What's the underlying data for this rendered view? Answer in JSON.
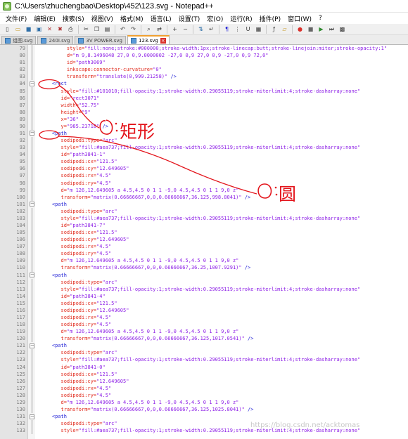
{
  "window": {
    "title": "C:\\Users\\zhuchengbao\\Desktop\\452\\123.svg - Notepad++"
  },
  "menu": [
    "文件(F)",
    "编辑(E)",
    "搜索(S)",
    "视图(V)",
    "格式(M)",
    "语言(L)",
    "设置(T)",
    "宏(O)",
    "运行(R)",
    "插件(P)",
    "窗口(W)",
    "?"
  ],
  "toolbar_icons": [
    "new-file-icon",
    "open-file-icon",
    "save-icon",
    "save-all-icon",
    "close-icon",
    "close-all-icon",
    "print-icon",
    "cut-icon",
    "copy-icon",
    "paste-icon",
    "undo-icon",
    "redo-icon",
    "find-icon",
    "replace-icon",
    "zoom-in-icon",
    "zoom-out-icon",
    "sync-scroll-icon",
    "word-wrap-icon",
    "show-all-chars-icon",
    "indent-guide-icon",
    "user-language-icon",
    "doc-map-icon",
    "function-list-icon",
    "folder-as-workspace-icon",
    "record-macro-icon",
    "stop-macro-icon",
    "play-macro-icon",
    "run-macro-icon",
    "save-macro-icon"
  ],
  "tabs": [
    {
      "label": "组图.svg",
      "active": false
    },
    {
      "label": "240I.svg",
      "active": false
    },
    {
      "label": "3V POWER.svg",
      "active": false
    },
    {
      "label": "123.svg",
      "active": true
    }
  ],
  "code_lines": [
    {
      "n": "79",
      "parts": [
        [
          "attr",
          "         style="
        ],
        [
          "val",
          "\"fill:none;stroke:#000000;stroke-width:1px;stroke-linecap:butt;stroke-linejoin:miter;stroke-opacity:1\""
        ]
      ]
    },
    {
      "n": "80",
      "parts": [
        [
          "attr",
          "         d="
        ],
        [
          "val",
          "\"m 9,8.1496048 27,0 0,9.0000002 -27,0 0,9 27,0 0,9 -27,0 0,9 72,0\""
        ]
      ]
    },
    {
      "n": "81",
      "parts": [
        [
          "attr",
          "         id="
        ],
        [
          "val",
          "\"path3069\""
        ]
      ]
    },
    {
      "n": "82",
      "parts": [
        [
          "attr",
          "         inkscape:connector-curvature="
        ],
        [
          "val",
          "\"0\""
        ]
      ]
    },
    {
      "n": "83",
      "parts": [
        [
          "attr",
          "         transform="
        ],
        [
          "val",
          "\"translate(0,999.21258)\""
        ],
        [
          "tag",
          " />"
        ]
      ]
    },
    {
      "n": "84",
      "parts": [
        [
          "tag",
          "    <rect"
        ]
      ]
    },
    {
      "n": "85",
      "parts": [
        [
          "attr",
          "       style="
        ],
        [
          "val",
          "\"fill:#101010;fill-opacity:1;stroke-width:0.29055119;stroke-miterlimit:4;stroke-dasharray:none\""
        ]
      ]
    },
    {
      "n": "86",
      "parts": [
        [
          "attr",
          "       id="
        ],
        [
          "val",
          "\"rect3071\""
        ]
      ]
    },
    {
      "n": "87",
      "parts": [
        [
          "attr",
          "       width="
        ],
        [
          "val",
          "\"52.75\""
        ]
      ]
    },
    {
      "n": "88",
      "parts": [
        [
          "attr",
          "       height="
        ],
        [
          "val",
          "\"9\""
        ]
      ]
    },
    {
      "n": "89",
      "parts": [
        [
          "attr",
          "       x="
        ],
        [
          "val",
          "\"36\""
        ]
      ]
    },
    {
      "n": "90",
      "parts": [
        [
          "attr",
          "       y="
        ],
        [
          "val",
          "\"985.23718\""
        ],
        [
          "tag",
          " />"
        ]
      ]
    },
    {
      "n": "91",
      "parts": [
        [
          "tag",
          "    <path"
        ]
      ]
    },
    {
      "n": "92",
      "parts": [
        [
          "attr",
          "       sodipodi:type="
        ],
        [
          "val",
          "\"arc\""
        ]
      ]
    },
    {
      "n": "93",
      "parts": [
        [
          "attr",
          "       style="
        ],
        [
          "val",
          "\"fill:#aea737;fill-opacity:1;stroke-width:0.29055119;stroke-miterlimit:4;stroke-dasharray:none\""
        ]
      ]
    },
    {
      "n": "94",
      "parts": [
        [
          "attr",
          "       id="
        ],
        [
          "val",
          "\"path3841-1\""
        ]
      ]
    },
    {
      "n": "95",
      "parts": [
        [
          "attr",
          "       sodipodi:cx="
        ],
        [
          "val",
          "\"121.5\""
        ]
      ]
    },
    {
      "n": "96",
      "parts": [
        [
          "attr",
          "       sodipodi:cy="
        ],
        [
          "val",
          "\"12.649605\""
        ]
      ]
    },
    {
      "n": "97",
      "parts": [
        [
          "attr",
          "       sodipodi:rx="
        ],
        [
          "val",
          "\"4.5\""
        ]
      ]
    },
    {
      "n": "98",
      "parts": [
        [
          "attr",
          "       sodipodi:ry="
        ],
        [
          "val",
          "\"4.5\""
        ]
      ]
    },
    {
      "n": "99",
      "parts": [
        [
          "attr",
          "       d="
        ],
        [
          "val",
          "\"m 126,12.649605 a 4.5,4.5 0 1 1 -9,0 4.5,4.5 0 1 1 9,0 z\""
        ]
      ]
    },
    {
      "n": "100",
      "parts": [
        [
          "attr",
          "       transform="
        ],
        [
          "val",
          "\"matrix(0.66666667,0,0,0.66666667,36.125,998.8041)\""
        ],
        [
          "tag",
          " />"
        ]
      ]
    },
    {
      "n": "101",
      "parts": [
        [
          "tag",
          "    <path"
        ]
      ]
    },
    {
      "n": "102",
      "parts": [
        [
          "attr",
          "       sodipodi:type="
        ],
        [
          "val",
          "\"arc\""
        ]
      ]
    },
    {
      "n": "103",
      "parts": [
        [
          "attr",
          "       style="
        ],
        [
          "val",
          "\"fill:#aea737;fill-opacity:1;stroke-width:0.29055119;stroke-miterlimit:4;stroke-dasharray:none\""
        ]
      ]
    },
    {
      "n": "104",
      "parts": [
        [
          "attr",
          "       id="
        ],
        [
          "val",
          "\"path3841-7\""
        ]
      ]
    },
    {
      "n": "105",
      "parts": [
        [
          "attr",
          "       sodipodi:cx="
        ],
        [
          "val",
          "\"121.5\""
        ]
      ]
    },
    {
      "n": "106",
      "parts": [
        [
          "attr",
          "       sodipodi:cy="
        ],
        [
          "val",
          "\"12.649605\""
        ]
      ]
    },
    {
      "n": "107",
      "parts": [
        [
          "attr",
          "       sodipodi:rx="
        ],
        [
          "val",
          "\"4.5\""
        ]
      ]
    },
    {
      "n": "108",
      "parts": [
        [
          "attr",
          "       sodipodi:ry="
        ],
        [
          "val",
          "\"4.5\""
        ]
      ]
    },
    {
      "n": "109",
      "parts": [
        [
          "attr",
          "       d="
        ],
        [
          "val",
          "\"m 126,12.649605 a 4.5,4.5 0 1 1 -9,0 4.5,4.5 0 1 1 9,0 z\""
        ]
      ]
    },
    {
      "n": "110",
      "parts": [
        [
          "attr",
          "       transform="
        ],
        [
          "val",
          "\"matrix(0.66666667,0,0,0.66666667,36.25,1007.9291)\""
        ],
        [
          "tag",
          " />"
        ]
      ]
    },
    {
      "n": "111",
      "parts": [
        [
          "tag",
          "    <path"
        ]
      ]
    },
    {
      "n": "112",
      "parts": [
        [
          "attr",
          "       sodipodi:type="
        ],
        [
          "val",
          "\"arc\""
        ]
      ]
    },
    {
      "n": "113",
      "parts": [
        [
          "attr",
          "       style="
        ],
        [
          "val",
          "\"fill:#aea737;fill-opacity:1;stroke-width:0.29055119;stroke-miterlimit:4;stroke-dasharray:none\""
        ]
      ]
    },
    {
      "n": "114",
      "parts": [
        [
          "attr",
          "       id="
        ],
        [
          "val",
          "\"path3841-4\""
        ]
      ]
    },
    {
      "n": "115",
      "parts": [
        [
          "attr",
          "       sodipodi:cx="
        ],
        [
          "val",
          "\"121.5\""
        ]
      ]
    },
    {
      "n": "116",
      "parts": [
        [
          "attr",
          "       sodipodi:cy="
        ],
        [
          "val",
          "\"12.649605\""
        ]
      ]
    },
    {
      "n": "117",
      "parts": [
        [
          "attr",
          "       sodipodi:rx="
        ],
        [
          "val",
          "\"4.5\""
        ]
      ]
    },
    {
      "n": "118",
      "parts": [
        [
          "attr",
          "       sodipodi:ry="
        ],
        [
          "val",
          "\"4.5\""
        ]
      ]
    },
    {
      "n": "119",
      "parts": [
        [
          "attr",
          "       d="
        ],
        [
          "val",
          "\"m 126,12.649605 a 4.5,4.5 0 1 1 -9,0 4.5,4.5 0 1 1 9,0 z\""
        ]
      ]
    },
    {
      "n": "120",
      "parts": [
        [
          "attr",
          "       transform="
        ],
        [
          "val",
          "\"matrix(0.66666667,0,0,0.66666667,36.125,1017.0541)\""
        ],
        [
          "tag",
          " />"
        ]
      ]
    },
    {
      "n": "121",
      "parts": [
        [
          "tag",
          "    <path"
        ]
      ]
    },
    {
      "n": "122",
      "parts": [
        [
          "attr",
          "       sodipodi:type="
        ],
        [
          "val",
          "\"arc\""
        ]
      ]
    },
    {
      "n": "123",
      "parts": [
        [
          "attr",
          "       style="
        ],
        [
          "val",
          "\"fill:#aea737;fill-opacity:1;stroke-width:0.29055119;stroke-miterlimit:4;stroke-dasharray:none\""
        ]
      ]
    },
    {
      "n": "124",
      "parts": [
        [
          "attr",
          "       id="
        ],
        [
          "val",
          "\"path3841-0\""
        ]
      ]
    },
    {
      "n": "125",
      "parts": [
        [
          "attr",
          "       sodipodi:cx="
        ],
        [
          "val",
          "\"121.5\""
        ]
      ]
    },
    {
      "n": "126",
      "parts": [
        [
          "attr",
          "       sodipodi:cy="
        ],
        [
          "val",
          "\"12.649605\""
        ]
      ]
    },
    {
      "n": "127",
      "parts": [
        [
          "attr",
          "       sodipodi:rx="
        ],
        [
          "val",
          "\"4.5\""
        ]
      ]
    },
    {
      "n": "128",
      "parts": [
        [
          "attr",
          "       sodipodi:ry="
        ],
        [
          "val",
          "\"4.5\""
        ]
      ]
    },
    {
      "n": "129",
      "parts": [
        [
          "attr",
          "       d="
        ],
        [
          "val",
          "\"m 126,12.649605 a 4.5,4.5 0 1 1 -9,0 4.5,4.5 0 1 1 9,0 z\""
        ]
      ]
    },
    {
      "n": "130",
      "parts": [
        [
          "attr",
          "       transform="
        ],
        [
          "val",
          "\"matrix(0.66666667,0,0,0.66666667,36.125,1025.8041)\""
        ],
        [
          "tag",
          " />"
        ]
      ]
    },
    {
      "n": "131",
      "parts": [
        [
          "tag",
          "    <path"
        ]
      ]
    },
    {
      "n": "132",
      "parts": [
        [
          "attr",
          "       sodipodi:type="
        ],
        [
          "val",
          "\"arc\""
        ]
      ]
    },
    {
      "n": "133",
      "parts": [
        [
          "attr",
          "       style="
        ],
        [
          "val",
          "\"fill:#aea737;fill-opacity:1;stroke-width:0.29055119;stroke-miterlimit:4;stroke-dasharray:none\""
        ]
      ]
    }
  ],
  "annotations": {
    "rect_note": "矩形",
    "circle_note": "圆"
  },
  "watermark": "https://blog.csdn.net/acktomas",
  "colors": {
    "tag": "#1f1fd6",
    "attribute": "#e0291b",
    "value": "#8c1ee6",
    "annotation_ink": "#e3141b",
    "active_tab_accent": "#f0a030"
  }
}
